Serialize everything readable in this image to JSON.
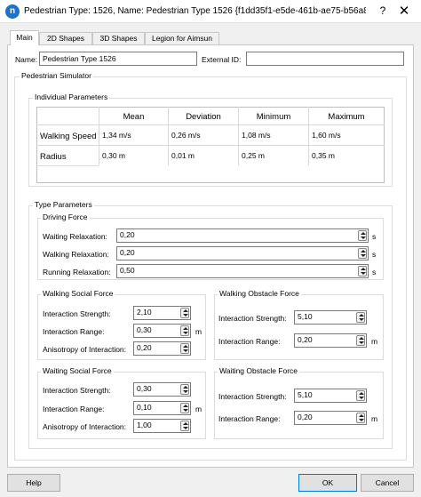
{
  "window": {
    "title": "Pedestrian Type: 1526, Name: Pedestrian Type 1526  {f1dd35f1-e5de-461b-ae75-b56a86dd2...",
    "help_glyph": "?",
    "close_glyph": "✕",
    "app_icon_letter": "n"
  },
  "tabs": [
    {
      "label": "Main",
      "active": true
    },
    {
      "label": "2D Shapes",
      "active": false
    },
    {
      "label": "3D Shapes",
      "active": false
    },
    {
      "label": "Legion for Aimsun",
      "active": false
    }
  ],
  "main": {
    "name_label": "Name:",
    "name_value": "Pedestrian Type 1526",
    "external_id_label": "External ID:",
    "external_id_value": "",
    "simulator_title": "Pedestrian Simulator",
    "individual": {
      "title": "Individual Parameters",
      "columns": [
        "Mean",
        "Deviation",
        "Minimum",
        "Maximum"
      ],
      "rows": [
        {
          "label": "Walking Speed",
          "cells": [
            "1,34 m/s",
            "0,26 m/s",
            "1,08 m/s",
            "1,60 m/s"
          ]
        },
        {
          "label": "Radius",
          "cells": [
            "0,30 m",
            "0,01 m",
            "0,25 m",
            "0,35 m"
          ]
        }
      ]
    },
    "type": {
      "title": "Type Parameters",
      "driving_force": {
        "title": "Driving Force",
        "waiting_label": "Waiting Relaxation:",
        "waiting_value": "0,20",
        "waiting_unit": "s",
        "walking_label": "Walking Relaxation:",
        "walking_value": "0,20",
        "walking_unit": "s",
        "running_label": "Running Relaxation:",
        "running_value": "0,50",
        "running_unit": "s"
      },
      "walking_social": {
        "title": "Walking Social Force",
        "strength_label": "Interaction Strength:",
        "strength_value": "2,10",
        "range_label": "Interaction Range:",
        "range_value": "0,30",
        "range_unit": "m",
        "anisotropy_label": "Anisotropy of Interaction:",
        "anisotropy_value": "0,20"
      },
      "walking_obstacle": {
        "title": "Walking Obstacle Force",
        "strength_label": "Interaction Strength:",
        "strength_value": "5,10",
        "range_label": "Interaction Range:",
        "range_value": "0,20",
        "range_unit": "m"
      },
      "waiting_social": {
        "title": "Waiting Social Force",
        "strength_label": "Interaction Strength:",
        "strength_value": "0,30",
        "range_label": "Interaction Range:",
        "range_value": "0,10",
        "range_unit": "m",
        "anisotropy_label": "Anisotropy of Interaction:",
        "anisotropy_value": "1,00"
      },
      "waiting_obstacle": {
        "title": "Waiting Obstacle Force",
        "strength_label": "Interaction Strength:",
        "strength_value": "5,10",
        "range_label": "Interaction Range:",
        "range_value": "0,20",
        "range_unit": "m"
      }
    }
  },
  "buttons": {
    "help": "Help",
    "ok": "OK",
    "cancel": "Cancel"
  },
  "colors": {
    "accent": "#0078d7",
    "app_icon": "#1e73c8"
  }
}
